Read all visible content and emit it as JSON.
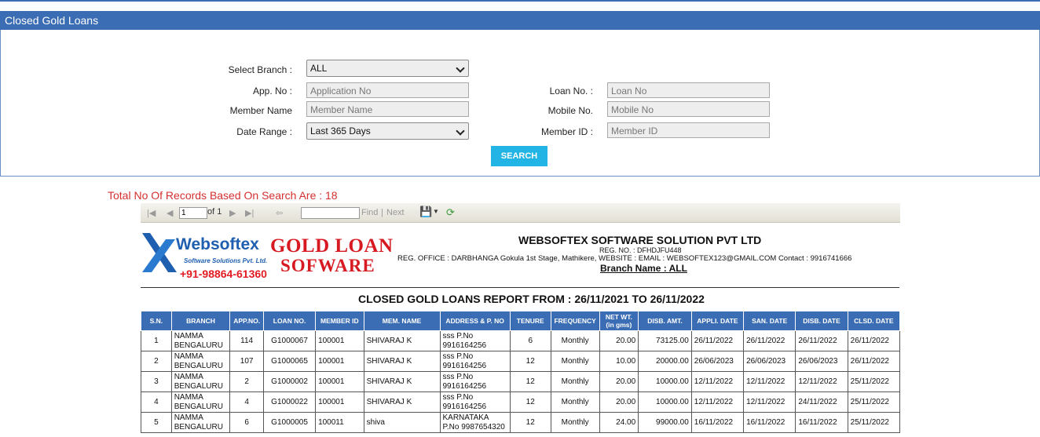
{
  "header": {
    "title": "Closed Gold Loans"
  },
  "form": {
    "branch_label": "Select Branch :",
    "branch_value": "ALL",
    "app_label": "App. No :",
    "app_placeholder": "Application No",
    "member_name_label": "Member Name",
    "member_name_placeholder": "Member Name",
    "date_range_label": "Date Range :",
    "date_range_value": "Last 365 Days",
    "loan_label": "Loan No. :",
    "loan_placeholder": "Loan No",
    "mobile_label": "Mobile No.",
    "mobile_placeholder": "Mobile No",
    "member_id_label": "Member ID :",
    "member_id_placeholder": "Member ID",
    "search_button": "SEARCH"
  },
  "records_text": "Total No Of Records Based On Search Are : 18",
  "toolbar": {
    "page_value": "1",
    "of_text": "of 1",
    "find_label": "Find",
    "separator": "|",
    "next_label": "Next"
  },
  "report": {
    "logo_title": "Websoftex",
    "logo_sub": "Software Solutions Pvt. Ltd.",
    "logo_phone": "+91-98864-61360",
    "gold_line1": "GOLD LOAN",
    "gold_line2": "SOFWARE",
    "company": "WEBSOFTEX SOFTWARE SOLUTION PVT LTD",
    "reg_no": "REG. NO. : DFHDJFU448",
    "office": "REG. OFFICE : DARBHANGA  Gokula 1st Stage, Mathikere, WEBSITE :         EMAIL : WEBSOFTEX123@GMAIL.COM   Contact : 9916741666",
    "branch_name": "Branch Name : ALL",
    "title": "CLOSED GOLD LOANS REPORT FROM : 26/11/2021 TO 26/11/2022"
  },
  "table": {
    "columns": [
      "S.N.",
      "BRANCH",
      "APP.NO.",
      "LOAN NO.",
      "MEMBER ID",
      "MEM. NAME",
      "ADDRESS & P. NO",
      "TENURE",
      "FREQUENCY",
      "NET WT. (in gms)",
      "DISB. AMT.",
      "APPLI. DATE",
      "SAN. DATE",
      "DISB. DATE",
      "CLSD. DATE"
    ],
    "rows": [
      [
        "1",
        "NAMMA BENGALURU",
        "114",
        "G1000067",
        "100001",
        "SHIVARAJ K",
        "sss  P.No 9916164256",
        "6",
        "Monthly",
        "20.00",
        "73125.00",
        "26/11/2022",
        "26/11/2022",
        "26/11/2022",
        "26/11/2022"
      ],
      [
        "2",
        "NAMMA BENGALURU",
        "107",
        "G1000065",
        "100001",
        "SHIVARAJ K",
        "sss  P.No 9916164256",
        "12",
        "Monthly",
        "10.00",
        "20000.00",
        "26/06/2023",
        "26/06/2023",
        "26/06/2023",
        "26/11/2022"
      ],
      [
        "3",
        "NAMMA BENGALURU",
        "2",
        "G1000002",
        "100001",
        "SHIVARAJ K",
        "sss  P.No 9916164256",
        "12",
        "Monthly",
        "20.00",
        "10000.00",
        "12/11/2022",
        "12/11/2022",
        "12/11/2022",
        "25/11/2022"
      ],
      [
        "4",
        "NAMMA BENGALURU",
        "4",
        "G1000022",
        "100001",
        "SHIVARAJ K",
        "sss  P.No 9916164256",
        "12",
        "Monthly",
        "20.00",
        "10000.00",
        "12/11/2022",
        "12/11/2022",
        "24/11/2022",
        "25/11/2022"
      ],
      [
        "5",
        "NAMMA BENGALURU",
        "6",
        "G1000005",
        "100011",
        "shiva",
        "KARNATAKA  P.No 9987654320",
        "12",
        "Monthly",
        "24.00",
        "99000.00",
        "16/11/2022",
        "16/11/2022",
        "16/11/2022",
        "25/11/2022"
      ]
    ]
  }
}
